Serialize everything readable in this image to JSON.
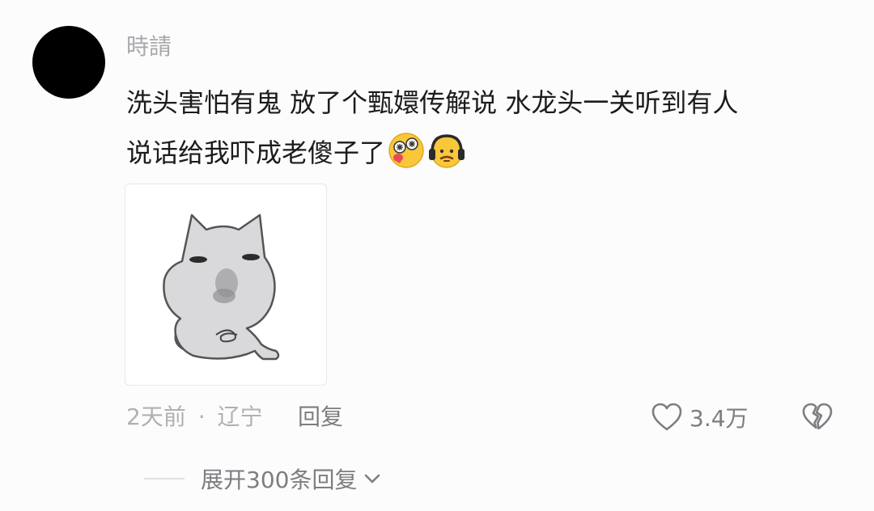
{
  "comment": {
    "username": "時請",
    "text_line1": "洗头害怕有鬼 放了个甄嬛传解说 水龙头一关听到有人",
    "text_line2": "说话给我吓成老傻子了",
    "emojis": [
      "drooling-dizzy-emoji",
      "headphones-face-emoji"
    ],
    "image_alt_icon": "cat-meme-sticker",
    "time": "2天前",
    "separator": "·",
    "location": "辽宁",
    "reply_label": "回复",
    "like_count": "3.4万",
    "expand_label": "展开300条回复"
  },
  "colors": {
    "meta_gray": "#b0b0b5",
    "action_gray": "#7d7d82",
    "text_dark": "#1c1c1e"
  }
}
